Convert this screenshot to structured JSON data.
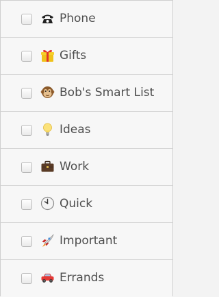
{
  "lists": [
    {
      "label": "Phone",
      "icon": "telephone-icon"
    },
    {
      "label": "Gifts",
      "icon": "gift-icon"
    },
    {
      "label": "Bob's Smart List",
      "icon": "monkey-face-icon"
    },
    {
      "label": "Ideas",
      "icon": "lightbulb-icon"
    },
    {
      "label": "Work",
      "icon": "briefcase-icon"
    },
    {
      "label": "Quick",
      "icon": "clock-icon"
    },
    {
      "label": "Important",
      "icon": "rocket-icon"
    },
    {
      "label": "Errands",
      "icon": "car-icon"
    }
  ]
}
